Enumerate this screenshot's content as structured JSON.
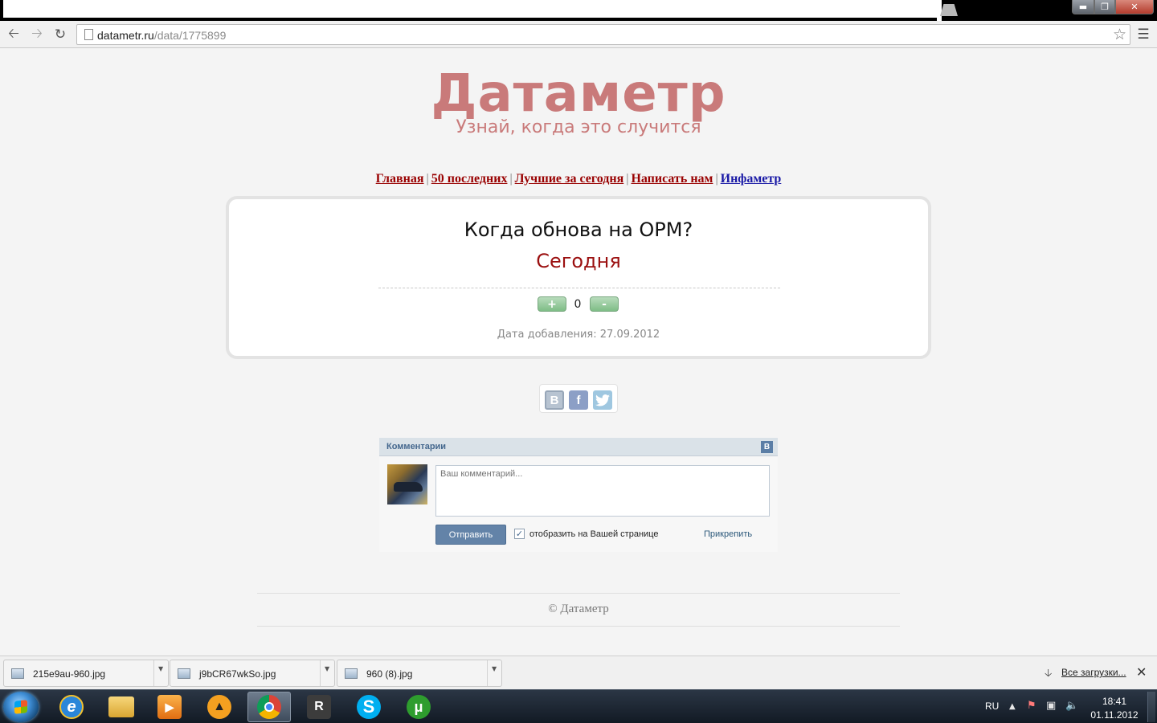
{
  "browser": {
    "url_host": "datametr.ru",
    "url_path": "/data/1775899"
  },
  "site": {
    "logo": "Датаметр",
    "slogan": "Узнай, когда это случится"
  },
  "nav": {
    "home": "Главная",
    "last50": "50 последних",
    "best_today": "Лучшие за сегодня",
    "write_us": "Написать нам",
    "infametr": "Инфаметр",
    "separator": "|"
  },
  "event": {
    "question": "Когда обнова на OPM?",
    "answer": "Сегодня",
    "vote_plus": "+",
    "vote_minus": "-",
    "vote_count": "0",
    "date_added": "Дата добавления: 27.09.2012"
  },
  "share": {
    "vk": "B",
    "fb": "f",
    "tw": "t"
  },
  "comments": {
    "title": "Комментарии",
    "vk_badge": "B",
    "placeholder": "Ваш комментарий...",
    "submit": "Отправить",
    "show_on_page": "отобразить на Вашей странице",
    "show_on_page_checked": true,
    "attach": "Прикрепить"
  },
  "footer": {
    "copyright": "© Датаметр"
  },
  "downloads": {
    "items": [
      {
        "name": "215e9au-960.jpg"
      },
      {
        "name": "j9bCR67wkSo.jpg"
      },
      {
        "name": "960 (8).jpg"
      }
    ],
    "all": "Все загрузки..."
  },
  "taskbar": {
    "apps": [
      "internet-explorer",
      "windows-explorer",
      "media-player",
      "aimp",
      "chrome",
      "rockstar",
      "skype",
      "utorrent"
    ],
    "active_app": "chrome",
    "language": "RU",
    "time": "18:41",
    "date": "01.11.2012"
  },
  "colors": {
    "logo": "#c97a7a",
    "nav_link": "#990000",
    "nav_link_alt": "#1a1aa6",
    "answer": "#9b1010",
    "vk_blue": "#45688e"
  }
}
